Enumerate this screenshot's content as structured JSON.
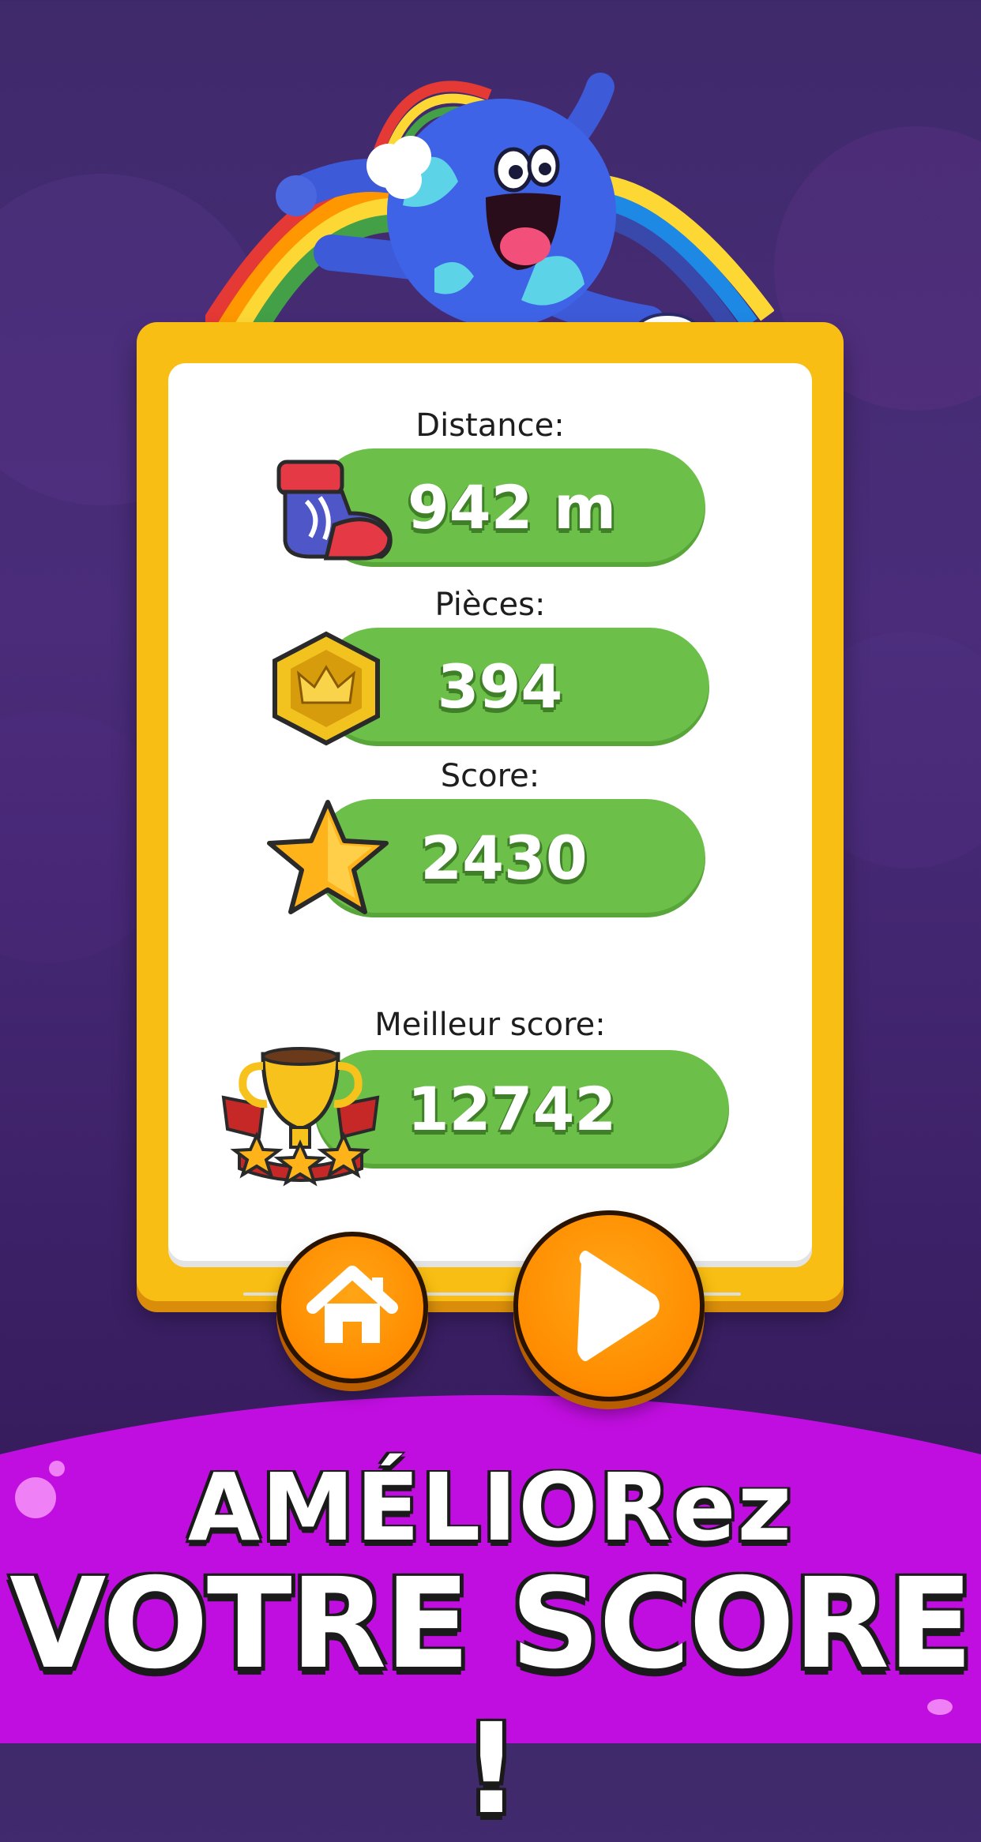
{
  "stats": {
    "distance": {
      "label": "Distance:",
      "value": "942 m",
      "icon": "boot-icon"
    },
    "coins": {
      "label": "Pièces:",
      "value": "394",
      "icon": "crown-coin-icon"
    },
    "score": {
      "label": "Score:",
      "value": "2430",
      "icon": "star-icon"
    },
    "best": {
      "label": "Meilleur score:",
      "value": "12742",
      "icon": "trophy-icon"
    }
  },
  "buttons": {
    "home": {
      "icon": "home-icon"
    },
    "play": {
      "icon": "play-icon"
    }
  },
  "promo": {
    "line1": "AMÉLIORez",
    "line2": "VOTRE SCORE !"
  },
  "colors": {
    "background": "#3f2a6b",
    "card_frame": "#f9be13",
    "pill_green": "#6cc04a",
    "button_orange": "#ff8c00",
    "wave_purple": "#c10ee0"
  }
}
